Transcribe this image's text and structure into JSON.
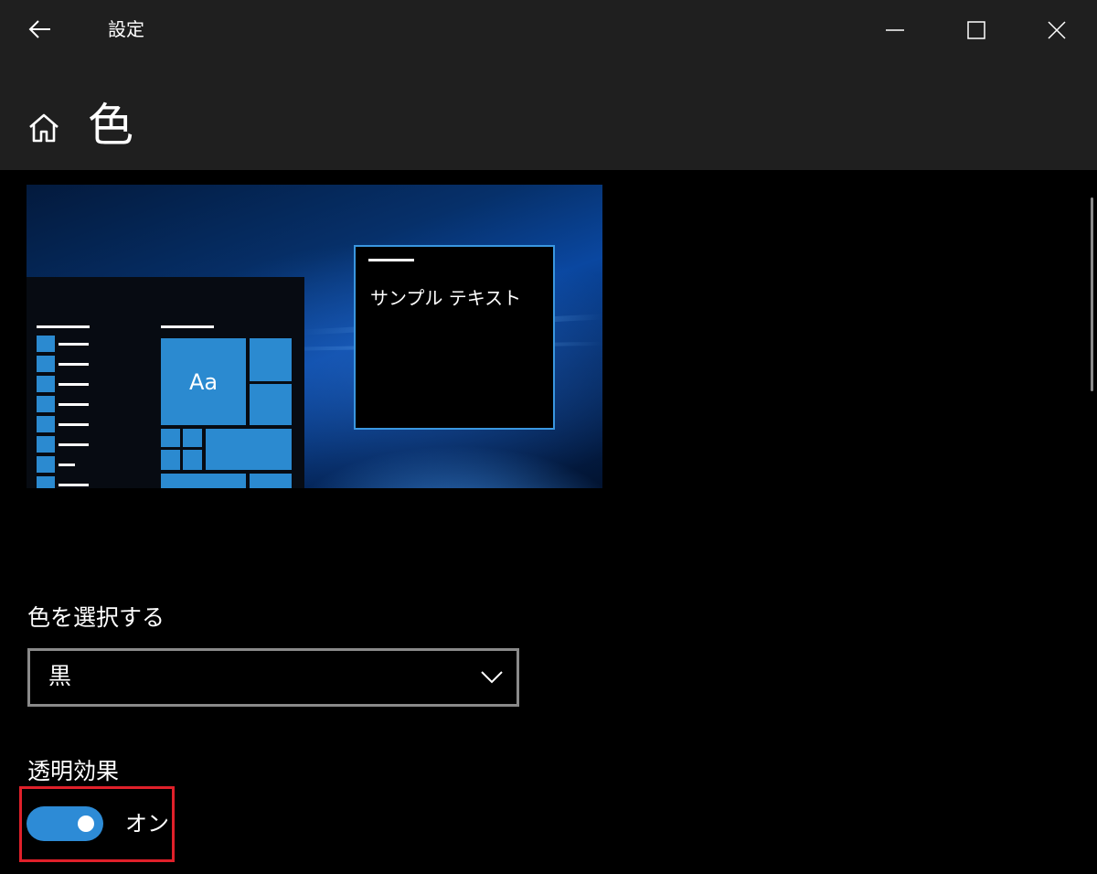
{
  "window": {
    "title": "設定",
    "controls": [
      "minimize",
      "maximize",
      "close"
    ]
  },
  "header": {
    "page_title": "色"
  },
  "preview": {
    "sample_text": "サンプル テキスト",
    "tile_label": "Aa"
  },
  "color_mode": {
    "label": "色を選択する",
    "selected": "黒"
  },
  "transparency": {
    "label": "透明効果",
    "state_label": "オン",
    "on": true
  },
  "colors": {
    "titlebar": "#1f1f1f",
    "background": "#000000",
    "accent": "#2d8bd6",
    "highlight": "#e0202a"
  }
}
